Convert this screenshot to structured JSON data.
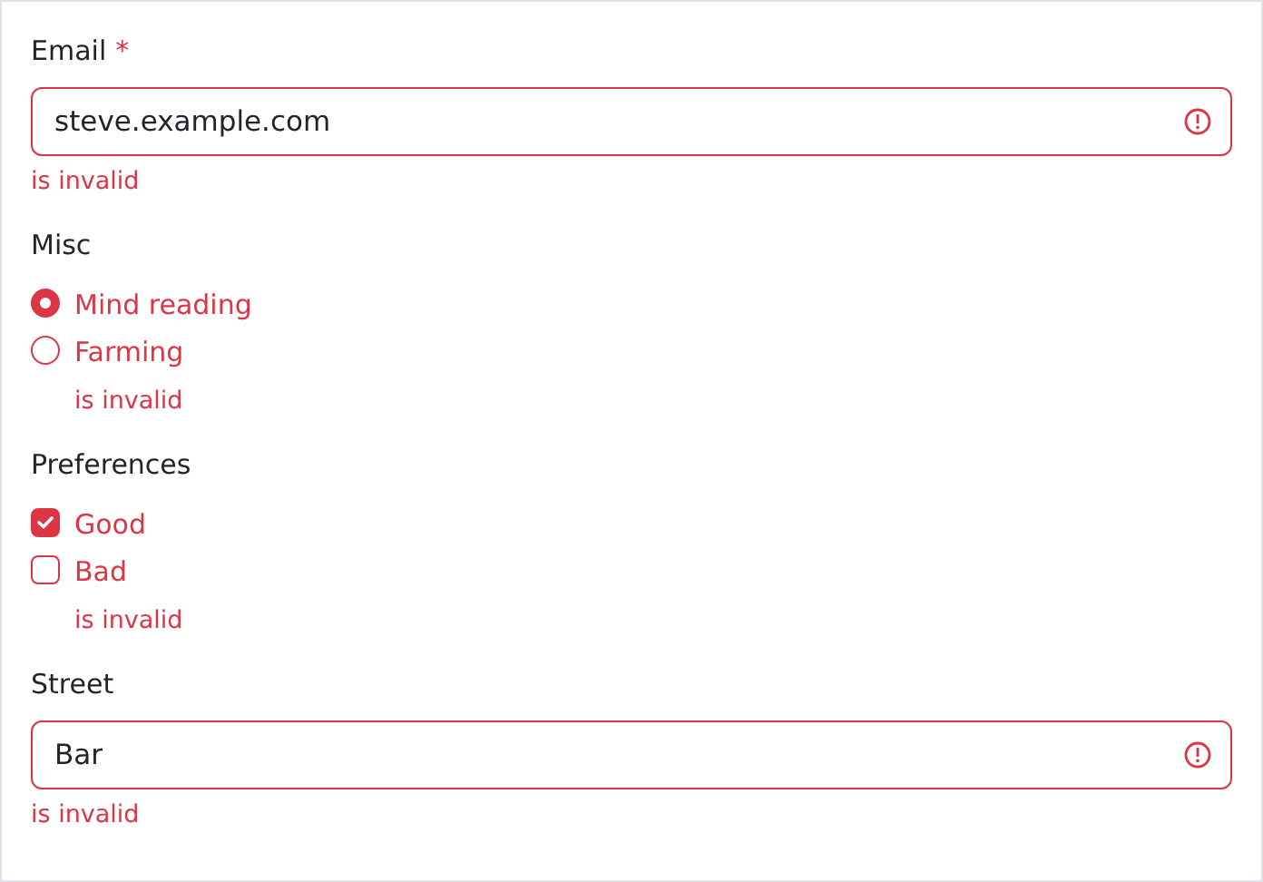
{
  "fields": [
    {
      "kind": "text",
      "label": "Email",
      "required_mark": "*",
      "value": "steve.example.com",
      "invalid": true,
      "error": "is invalid"
    },
    {
      "kind": "radio",
      "label": "Misc",
      "invalid": true,
      "options": [
        {
          "label": "Mind reading",
          "selected": true
        },
        {
          "label": "Farming",
          "selected": false
        }
      ],
      "error": "is invalid"
    },
    {
      "kind": "checkbox",
      "label": "Preferences",
      "invalid": true,
      "options": [
        {
          "label": "Good",
          "checked": true
        },
        {
          "label": "Bad",
          "checked": false
        }
      ],
      "error": "is invalid"
    },
    {
      "kind": "text",
      "label": "Street",
      "value": "Bar",
      "invalid": true,
      "error": "is invalid"
    }
  ]
}
